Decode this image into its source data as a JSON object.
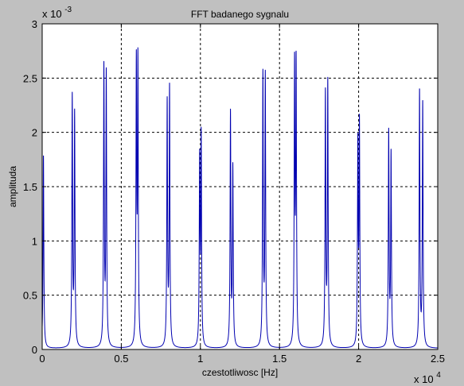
{
  "chart_data": {
    "type": "line",
    "title": "FFT badanego sygnalu",
    "xlabel": "czestotliwosc [Hz]",
    "ylabel": "amplituda",
    "x_exponent_label": "x 10",
    "x_exponent_power": "4",
    "y_exponent_label": "x 10",
    "y_exponent_power": "-3",
    "xlim": [
      0,
      25000
    ],
    "ylim": [
      0,
      0.003
    ],
    "grid": true,
    "x_ticks": [
      0,
      5000,
      10000,
      15000,
      20000,
      25000
    ],
    "x_tick_labels": [
      "0",
      "0.5",
      "1",
      "1.5",
      "2",
      "2.5"
    ],
    "y_ticks": [
      0,
      0.0005,
      0.001,
      0.0015,
      0.002,
      0.0025,
      0.003
    ],
    "y_tick_labels": [
      "0",
      "0.5",
      "1",
      "1.5",
      "2",
      "2.5",
      "3"
    ],
    "line_color": "#0000b0",
    "series": [
      {
        "peaks": [
          {
            "x": 80,
            "y": 0.00178
          },
          {
            "x": 1900,
            "y": 0.00229
          },
          {
            "x": 2050,
            "y": 0.00213
          },
          {
            "x": 3900,
            "y": 0.00256
          },
          {
            "x": 4050,
            "y": 0.0025
          },
          {
            "x": 5950,
            "y": 0.00257
          },
          {
            "x": 6050,
            "y": 0.00259
          },
          {
            "x": 7900,
            "y": 0.00224
          },
          {
            "x": 8050,
            "y": 0.00237
          },
          {
            "x": 9950,
            "y": 0.0017
          },
          {
            "x": 10050,
            "y": 0.00192
          },
          {
            "x": 11900,
            "y": 0.00215
          },
          {
            "x": 12050,
            "y": 0.00164
          },
          {
            "x": 13950,
            "y": 0.00249
          },
          {
            "x": 14100,
            "y": 0.00248
          },
          {
            "x": 15950,
            "y": 0.00255
          },
          {
            "x": 16050,
            "y": 0.00256
          },
          {
            "x": 17900,
            "y": 0.00232
          },
          {
            "x": 18050,
            "y": 0.00242
          },
          {
            "x": 19950,
            "y": 0.00184
          },
          {
            "x": 20050,
            "y": 0.00203
          },
          {
            "x": 21900,
            "y": 0.00197
          },
          {
            "x": 22050,
            "y": 0.00177
          },
          {
            "x": 23850,
            "y": 0.00236
          },
          {
            "x": 24050,
            "y": 0.00225
          }
        ]
      }
    ]
  }
}
